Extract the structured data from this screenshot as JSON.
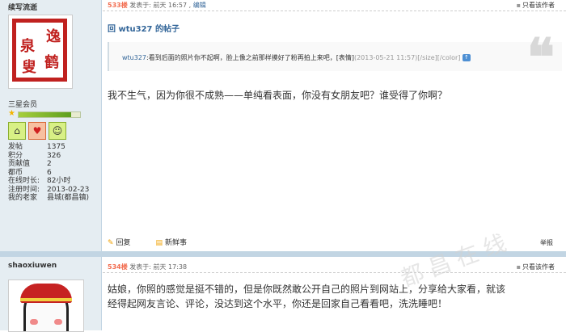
{
  "post1": {
    "author": "续写流逝",
    "avatar_text": [
      "泉",
      "逸",
      "鹤",
      "叟"
    ],
    "rank": "三星会员",
    "rank_progress": 0.85,
    "medals": [
      "home-medal-icon",
      "heart-medal-icon",
      "bee-medal-icon"
    ],
    "stats": [
      {
        "k": "发帖",
        "v": "1375"
      },
      {
        "k": "积分",
        "v": "326"
      },
      {
        "k": "贡献值",
        "v": "2"
      },
      {
        "k": "都币",
        "v": "6"
      },
      {
        "k": "在线时长:",
        "v": "82小时"
      },
      {
        "k": "注册时间:",
        "v": "2013-02-23"
      },
      {
        "k": "我的老家",
        "v": "县城(都昌镇)"
      }
    ],
    "floor": "533楼",
    "posted": "发表于: 前天 16:57",
    "edit": "编辑",
    "only_author": "只看该作者",
    "reply_title": "回 wtu327 的帖子",
    "quote": {
      "user": "wtu327",
      "text": ":看到后面的照片你不起啊，脸上像之前那样摸好了粉再拍上来吧，[表情]",
      "date": "(2013-05-21 11:57)[/size][/color]"
    },
    "content": "我不生气，因为你很不成熟——单纯看表面，你没有女朋友吧？谁受得了你啊？",
    "reply_btn": "回复",
    "news_btn": "新鲜事",
    "report": "举报"
  },
  "post2": {
    "author": "shaoxiuwen",
    "floor": "534楼",
    "posted": "发表于: 前天 17:38",
    "only_author": "只看该作者",
    "content_line1": "姑娘，你照的感觉是挺不错的，但是你既然敢公开自己的照片到网站上，分享给大家看，就该",
    "content_line2": "经得起网友言论、评论，没达到这个水平，你还是回家自己看看吧，洗洗睡吧！"
  },
  "watermark": "都昌在线"
}
